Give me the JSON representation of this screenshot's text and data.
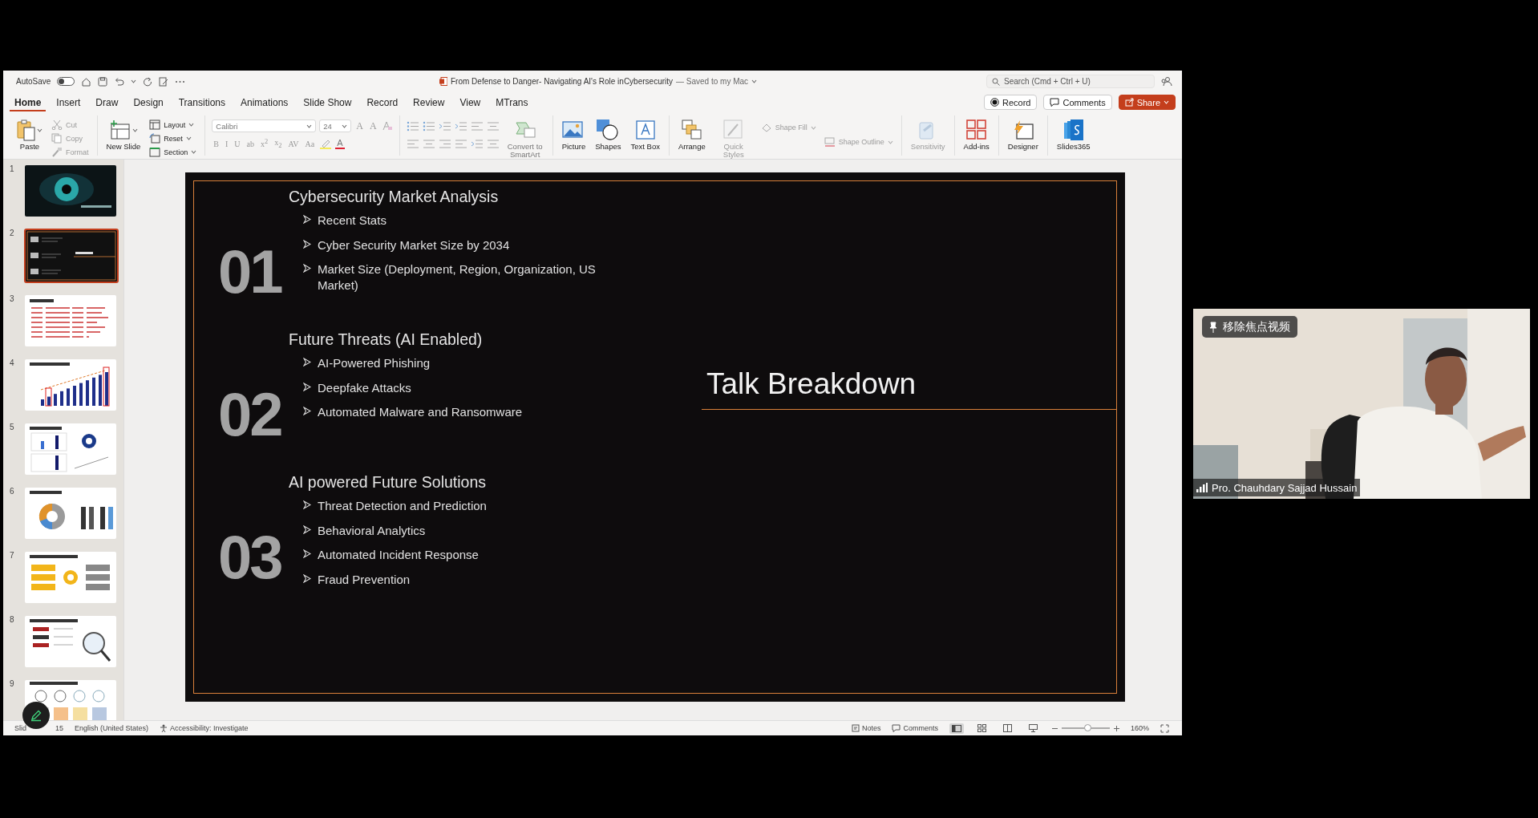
{
  "title_bar": {
    "autosave_label": "AutoSave",
    "autosave_on": false,
    "document_title": "From Defense to Danger- Navigating AI's Role inCybersecurity",
    "save_status": "— Saved to my Mac",
    "search_placeholder": "Search (Cmd + Ctrl + U)"
  },
  "tabs": [
    {
      "label": "Home",
      "selected": true
    },
    {
      "label": "Insert",
      "selected": false
    },
    {
      "label": "Draw",
      "selected": false
    },
    {
      "label": "Design",
      "selected": false
    },
    {
      "label": "Transitions",
      "selected": false
    },
    {
      "label": "Animations",
      "selected": false
    },
    {
      "label": "Slide Show",
      "selected": false
    },
    {
      "label": "Record",
      "selected": false
    },
    {
      "label": "Review",
      "selected": false
    },
    {
      "label": "View",
      "selected": false
    },
    {
      "label": "MTrans",
      "selected": false
    }
  ],
  "actions": {
    "record": "Record",
    "comments": "Comments",
    "share": "Share"
  },
  "ribbon": {
    "paste": "Paste",
    "clipboard": [
      {
        "label": "Cut",
        "kind": "cut",
        "disabled": true
      },
      {
        "label": "Copy",
        "kind": "copy",
        "disabled": true
      },
      {
        "label": "Format",
        "kind": "brush",
        "disabled": true
      }
    ],
    "new_slide": "New Slide",
    "slides": [
      {
        "label": "Layout",
        "kind": "layout",
        "disabled": false
      },
      {
        "label": "Reset",
        "kind": "reset",
        "disabled": false
      },
      {
        "label": "Section",
        "kind": "section",
        "disabled": false
      }
    ],
    "font": {
      "name": "Calibri",
      "size": "24",
      "size_buttons": [
        "A",
        "A"
      ],
      "format_buttons": [
        "B",
        "I",
        "U",
        "ab",
        "x$^{2}$",
        "x$_{2}$",
        "AV",
        "Aa"
      ],
      "color_button": "A"
    },
    "smartart": "Convert to SmartArt",
    "groups": [
      [
        {
          "label": "Picture",
          "kind": "picture",
          "disabled": false
        },
        {
          "label": "Shapes",
          "kind": "shapes",
          "disabled": false
        },
        {
          "label": "Text Box",
          "kind": "textbox",
          "disabled": false
        }
      ],
      [
        {
          "label": "Arrange",
          "kind": "arrange",
          "disabled": false
        },
        {
          "label": "Quick Styles",
          "kind": "quickstyles",
          "disabled": true
        },
        {
          "label": "Shape Fill",
          "kind": "fill",
          "disabled": true
        },
        {
          "label": "Shape Outline",
          "kind": "outline",
          "disabled": true
        }
      ],
      [
        {
          "label": "Sensitivity",
          "kind": "sensitivity",
          "disabled": true
        }
      ],
      [
        {
          "label": "Add-ins",
          "kind": "addins",
          "disabled": false
        }
      ],
      [
        {
          "label": "Designer",
          "kind": "designer",
          "disabled": false
        }
      ],
      [
        {
          "label": "Slides365",
          "kind": "slides365",
          "disabled": false
        }
      ]
    ]
  },
  "thumbnails": [
    {
      "number": "1",
      "kind": "eye",
      "selected": false
    },
    {
      "number": "2",
      "kind": "agenda",
      "selected": true
    },
    {
      "number": "3",
      "kind": "text",
      "selected": false
    },
    {
      "number": "4",
      "kind": "bars",
      "selected": false
    },
    {
      "number": "5",
      "kind": "charts",
      "selected": false
    },
    {
      "number": "6",
      "kind": "donut",
      "selected": false
    },
    {
      "number": "7",
      "kind": "process",
      "selected": false
    },
    {
      "number": "8",
      "kind": "magnifier",
      "selected": false
    },
    {
      "number": "9",
      "kind": "icons",
      "selected": false
    }
  ],
  "slide": {
    "title": "Talk Breakdown",
    "sections": [
      {
        "number": "01",
        "heading": "Cybersecurity Market Analysis",
        "bullets": [
          "Recent Stats",
          "Cyber Security Market Size by 2034",
          "Market Size (Deployment, Region, Organization, US Market)"
        ]
      },
      {
        "number": "02",
        "heading": "Future Threats (AI Enabled)",
        "bullets": [
          "AI-Powered Phishing",
          "Deepfake Attacks",
          "Automated Malware and Ransomware"
        ]
      },
      {
        "number": "03",
        "heading": "AI powered Future Solutions",
        "bullets": [
          "Threat Detection and Prediction",
          "Behavioral Analytics",
          "Automated Incident Response",
          "Fraud Prevention"
        ]
      }
    ]
  },
  "status_bar": {
    "slide_start": "Slid",
    "slide_end": "15",
    "language": "English (United States)",
    "accessibility": "Accessibility: Investigate",
    "notes": "Notes",
    "comments": "Comments",
    "zoom": {
      "level": 0.55
    },
    "zoom_label": "160%"
  },
  "video": {
    "pin_label": "移除焦点视频",
    "name": "Pro. Chauhdary Sajjad Hussain"
  }
}
